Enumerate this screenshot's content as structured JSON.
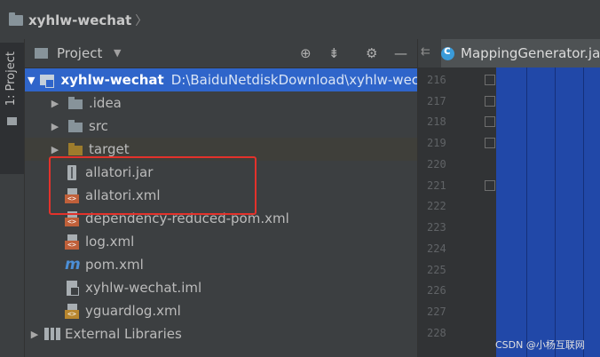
{
  "breadcrumb": {
    "project": "xyhlw-wechat",
    "separator": "〉"
  },
  "sidebar_stripe": {
    "tab_label": "1: Project"
  },
  "project_panel": {
    "title": "Project",
    "dropdown_icon": "chevron-down-icon",
    "tools": [
      "target-icon",
      "collapse-icon",
      "gear-icon",
      "minimize-icon"
    ]
  },
  "tree": {
    "root": {
      "name": "xyhlw-wechat",
      "path": "D:\\BaiduNetdiskDownload\\xyhlw-wech"
    },
    "items": [
      {
        "label": ".idea",
        "icon": "folder-icon"
      },
      {
        "label": "src",
        "icon": "folder-icon"
      },
      {
        "label": "target",
        "icon": "target-folder-icon"
      },
      {
        "label": "allatori.jar",
        "icon": "jar-icon"
      },
      {
        "label": "allatori.xml",
        "icon": "xml-icon"
      },
      {
        "label": "dependency-reduced-pom.xml",
        "icon": "xml-icon"
      },
      {
        "label": "log.xml",
        "icon": "xml-icon"
      },
      {
        "label": "pom.xml",
        "icon": "maven-icon"
      },
      {
        "label": "xyhlw-wechat.iml",
        "icon": "iml-icon"
      },
      {
        "label": "yguardlog.xml",
        "icon": "xml-icon"
      }
    ],
    "external_libraries": "External Libraries"
  },
  "editor": {
    "tab_file": "MappingGenerator.ja",
    "line_numbers": [
      "216",
      "217",
      "218",
      "219",
      "220",
      "221",
      "222",
      "223",
      "224",
      "225",
      "226",
      "227",
      "228"
    ]
  },
  "watermark": "CSDN @小杨互联网",
  "colors": {
    "selection": "#2f65ca",
    "highlight_box": "#e3322b",
    "panel_bg": "#3c3f41"
  }
}
